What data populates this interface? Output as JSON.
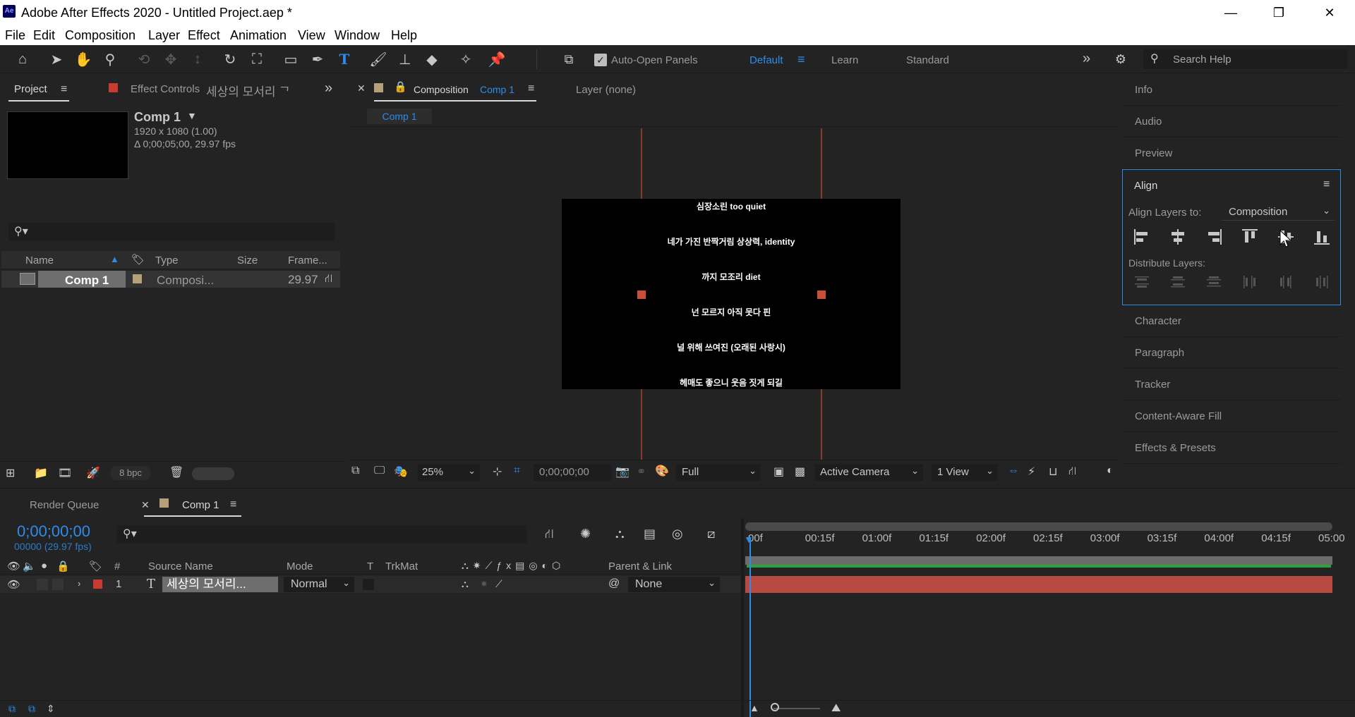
{
  "window": {
    "app_icon": "Ae",
    "title": "Adobe After Effects 2020 - Untitled Project.aep *",
    "minimize": "—",
    "restore": "❐",
    "close": "✕"
  },
  "menu": [
    "File",
    "Edit",
    "Composition",
    "Layer",
    "Effect",
    "Animation",
    "View",
    "Window",
    "Help"
  ],
  "toolbar": {
    "auto_open_panels": "Auto-Open Panels",
    "workspaces": {
      "default": "Default",
      "learn": "Learn",
      "standard": "Standard"
    },
    "search_placeholder": "Search Help",
    "overflow": "»"
  },
  "project_panel": {
    "tab_project": "Project",
    "tab_effect_controls": "Effect Controls",
    "effect_controls_target": "세상의 모서리 ᄀ",
    "comp_name": "Comp 1",
    "comp_res": "1920 x 1080 (1.00)",
    "comp_duration": "Δ 0;00;05;00, 29.97 fps",
    "columns": {
      "name": "Name",
      "type": "Type",
      "size": "Size",
      "frame": "Frame..."
    },
    "items": [
      {
        "name": "Comp 1",
        "type": "Composi...",
        "frame": "29.97"
      }
    ],
    "bpc": "8 bpc",
    "accent": "#2d8ceb"
  },
  "composition_panel": {
    "tab_label": "Composition",
    "tab_comp": "Comp 1",
    "layer_tab": "Layer (none)",
    "breadcrumb": "Comp 1",
    "subtitles": [
      "심장소린 too quiet",
      "네가 가진 반짝거림 상상력, identity",
      "까지 모조리 diet",
      "넌 모르지 아직 못다 핀",
      "널 위해 쓰여진 (오래된 사랑시)",
      "헤매도 좋으니 웃음 짓게 되길"
    ],
    "zoom": "25%",
    "timecode": "0;00;00;00",
    "resolution": "Full",
    "camera": "Active Camera",
    "views": "1 View",
    "guide_color": "#c94f38"
  },
  "right_panels": {
    "info": "Info",
    "audio": "Audio",
    "preview": "Preview",
    "align": "Align",
    "align_layers_to": "Align Layers to:",
    "align_target": "Composition",
    "distribute_layers": "Distribute Layers:",
    "character": "Character",
    "paragraph": "Paragraph",
    "tracker": "Tracker",
    "content_aware_fill": "Content-Aware Fill",
    "effects_presets": "Effects & Presets"
  },
  "timeline": {
    "tab_render_queue": "Render Queue",
    "tab_comp": "Comp 1",
    "timecode": "0;00;00;00",
    "frame_info": "00000 (29.97 fps)",
    "columns": {
      "hash": "#",
      "source_name": "Source Name",
      "mode": "Mode",
      "t": "T",
      "trkmat": "TrkMat",
      "parent": "Parent & Link"
    },
    "layers": [
      {
        "index": "1",
        "type_icon": "T",
        "name": "세상의 모서리...",
        "mode": "Normal",
        "parent": "None"
      }
    ],
    "ticks": [
      "00f",
      "00:15f",
      "01:00f",
      "01:15f",
      "02:00f",
      "02:15f",
      "03:00f",
      "03:15f",
      "04:00f",
      "04:15f",
      "05:00"
    ],
    "layer_bar_color": "#b84a42",
    "work_area_color": "#2aa33a"
  }
}
